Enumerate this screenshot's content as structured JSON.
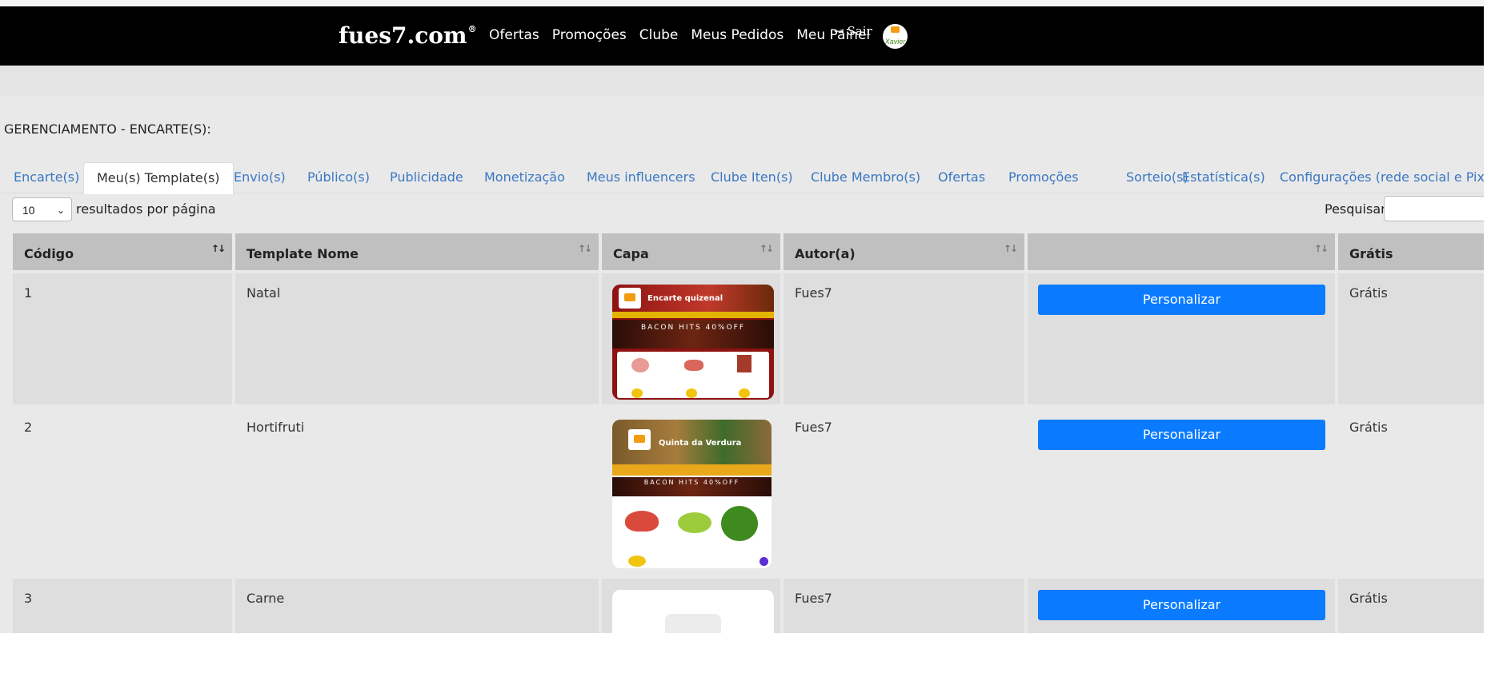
{
  "brand": {
    "name": "fues7.com",
    "mark": "®"
  },
  "nav": {
    "items": [
      "Ofertas",
      "Promoções",
      "Clube",
      "Meus Pedidos",
      "Meu Painel"
    ],
    "logout": "Sair",
    "avatar_text": "Xavier"
  },
  "page_title": "GERENCIAMENTO - ENCARTE(S):",
  "tabs": [
    {
      "label": "Encarte(s)"
    },
    {
      "label": "Meu(s) Template(s)"
    },
    {
      "label": "Envio(s)"
    },
    {
      "label": "Público(s)"
    },
    {
      "label": "Publicidade"
    },
    {
      "label": "Monetização"
    },
    {
      "label": "Meus influencers"
    },
    {
      "label": "Clube Iten(s)"
    },
    {
      "label": "Clube Membro(s)"
    },
    {
      "label": "Ofertas"
    },
    {
      "label": "Promoções"
    },
    {
      "label": "Sorteio(s)"
    },
    {
      "label": "Estatística(s)"
    },
    {
      "label": "Configurações (rede social e Pixel)"
    }
  ],
  "active_tab": "Meu(s) Template(s)",
  "length": {
    "value": "10",
    "label": "resultados por página"
  },
  "search": {
    "label": "Pesquisar",
    "value": ""
  },
  "table": {
    "headers": [
      "Código",
      "Template Nome",
      "Capa",
      "Autor(a)",
      "",
      "Grátis"
    ],
    "rows": [
      {
        "code": "1",
        "name": "Natal",
        "cover_title": "Encarte quizenal",
        "author": "Fues7",
        "action": "Personalizar",
        "price": "Grátis"
      },
      {
        "code": "2",
        "name": "Hortifruti",
        "cover_title": "Quinta da Verdura",
        "author": "Fues7",
        "action": "Personalizar",
        "price": "Grátis"
      },
      {
        "code": "3",
        "name": "Carne",
        "cover_title": "",
        "author": "Fues7",
        "action": "Personalizar",
        "price": "Grátis"
      }
    ]
  },
  "cover_banner": "BACON HITS 40%OFF",
  "colors": {
    "navbar": "#000000",
    "link": "#3a78c3",
    "button": "#0a7bff",
    "header": "#c0c0c0"
  }
}
